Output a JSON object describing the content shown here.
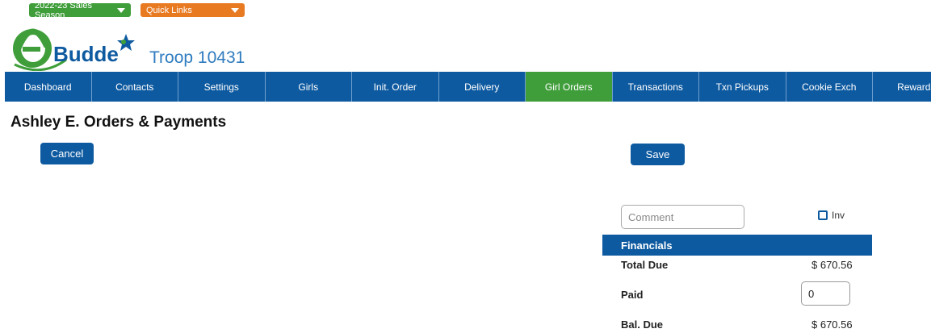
{
  "top_dropdowns": {
    "season": "2022-23 Sales Season",
    "quick_links": "Quick Links"
  },
  "brand": {
    "logo_text": "eBudde",
    "troop": "Troop 10431",
    "colors": {
      "green": "#3f9e3a",
      "blue": "#0e5aa0",
      "orange": "#e87a22"
    }
  },
  "nav": {
    "items": [
      "Dashboard",
      "Contacts",
      "Settings",
      "Girls",
      "Init. Order",
      "Delivery",
      "Girl Orders",
      "Transactions",
      "Txn Pickups",
      "Cookie Exch",
      "Rewards"
    ],
    "active": "Girl Orders"
  },
  "page": {
    "title": "Ashley E. Orders & Payments"
  },
  "buttons": {
    "cancel": "Cancel",
    "save": "Save"
  },
  "comment": {
    "placeholder": "Comment",
    "value": ""
  },
  "inv": {
    "label": "Inv",
    "checked": false
  },
  "financials": {
    "header": "Financials",
    "total_due_label": "Total Due",
    "total_due_value": "$ 670.56",
    "paid_label": "Paid",
    "paid_value": "0",
    "bal_due_label": "Bal. Due",
    "bal_due_value": "$ 670.56"
  }
}
